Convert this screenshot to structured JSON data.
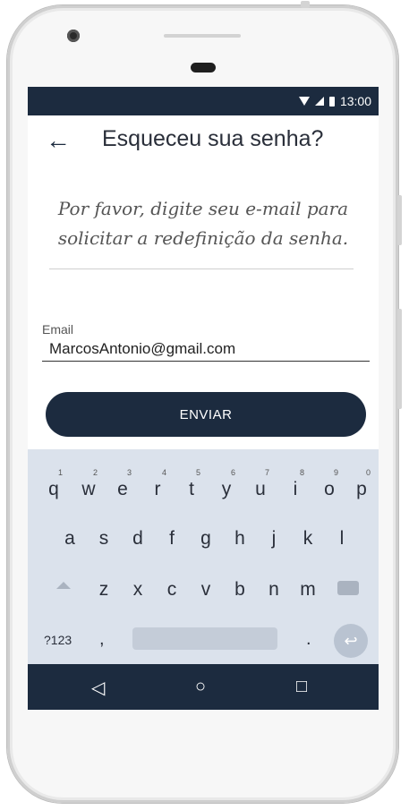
{
  "status": {
    "time": "13:00"
  },
  "header": {
    "title": "Esqueceu sua senha?"
  },
  "instruction": {
    "line1": "Por favor, digite seu e-mail para",
    "line2": "solicitar a redefinição da senha."
  },
  "email": {
    "label": "Email",
    "value": "MarcosAntonio@gmail.com"
  },
  "send": {
    "label": "ENVIAR"
  },
  "keyboard": {
    "row1": [
      {
        "k": "q",
        "n": "1"
      },
      {
        "k": "w",
        "n": "2"
      },
      {
        "k": "e",
        "n": "3"
      },
      {
        "k": "r",
        "n": "4"
      },
      {
        "k": "t",
        "n": "5"
      },
      {
        "k": "y",
        "n": "6"
      },
      {
        "k": "u",
        "n": "7"
      },
      {
        "k": "i",
        "n": "8"
      },
      {
        "k": "o",
        "n": "9"
      },
      {
        "k": "p",
        "n": "0"
      }
    ],
    "row2": [
      "a",
      "s",
      "d",
      "f",
      "g",
      "h",
      "j",
      "k",
      "l"
    ],
    "row3": [
      "z",
      "x",
      "c",
      "v",
      "b",
      "n",
      "m"
    ],
    "row4": {
      "sym": "?123",
      "comma": ",",
      "period": "."
    }
  },
  "nav": {
    "back": "◁",
    "home": "○",
    "recents": "□"
  },
  "icons": {
    "back_arrow": "arrow-left-icon",
    "enter": "enter-icon",
    "shift": "shift-icon",
    "backspace": "backspace-icon"
  },
  "colors": {
    "accent": "#1c2b3f",
    "keyboard_bg": "#dbe2ec"
  }
}
